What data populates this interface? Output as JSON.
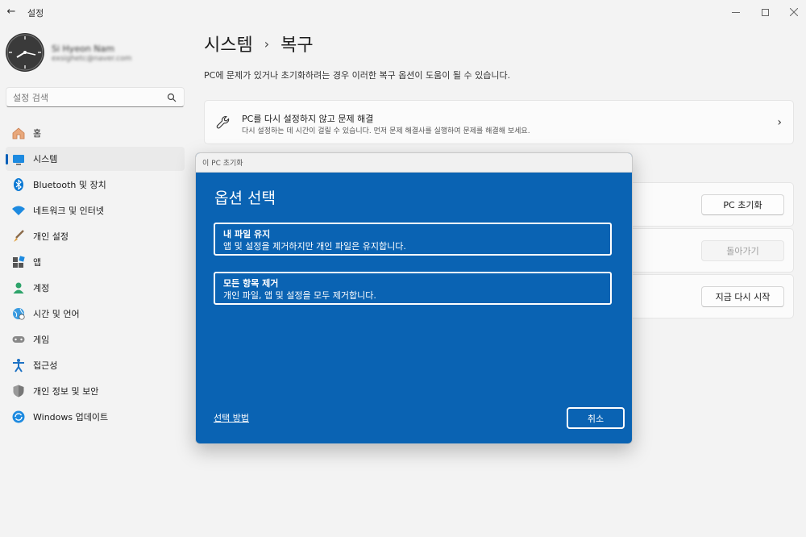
{
  "window": {
    "app_title": "설정",
    "back_icon": "back-arrow-icon"
  },
  "profile": {
    "name": "Si Hyeon Nam",
    "email": "exsighetc@naver.com"
  },
  "search": {
    "placeholder": "설정 검색"
  },
  "sidebar": {
    "items": [
      {
        "label": "홈",
        "icon": "home-icon"
      },
      {
        "label": "시스템",
        "icon": "system-icon",
        "active": true
      },
      {
        "label": "Bluetooth 및 장치",
        "icon": "bluetooth-icon"
      },
      {
        "label": "네트워크 및 인터넷",
        "icon": "network-icon"
      },
      {
        "label": "개인 설정",
        "icon": "brush-icon"
      },
      {
        "label": "앱",
        "icon": "apps-icon"
      },
      {
        "label": "계정",
        "icon": "account-icon"
      },
      {
        "label": "시간 및 언어",
        "icon": "globe-icon"
      },
      {
        "label": "게임",
        "icon": "gamepad-icon"
      },
      {
        "label": "접근성",
        "icon": "accessibility-icon"
      },
      {
        "label": "개인 정보 및 보안",
        "icon": "shield-icon"
      },
      {
        "label": "Windows 업데이트",
        "icon": "update-icon"
      }
    ]
  },
  "main": {
    "breadcrumb": [
      "시스템",
      "복구"
    ],
    "breadcrumb_sep": "›",
    "description": "PC에 문제가 있거나 초기화하려는 경우 이러한 복구 옵션이 도움이 될 수 있습니다.",
    "fix_card": {
      "title": "PC를 다시 설정하지 않고 문제 해결",
      "subtitle": "다시 설정하는 데 시간이 걸릴 수 있습니다. 먼저 문제 해결사를 실행하여 문제를 해결해 보세요."
    },
    "buttons": {
      "reset": "PC 초기화",
      "go_back": "돌아가기",
      "restart_now": "지금 다시 시작"
    }
  },
  "dialog": {
    "window_title": "이 PC 초기화",
    "heading": "옵션 선택",
    "options": [
      {
        "title": "내 파일 유지",
        "description": "앱 및 설정을 제거하지만 개인 파일은 유지합니다."
      },
      {
        "title": "모든 항목 제거",
        "description": "개인 파일, 앱 및 설정을 모두 제거합니다."
      }
    ],
    "help_link": "선택 방법",
    "cancel": "취소",
    "colors": {
      "background": "#0a63b3",
      "text": "#ffffff"
    }
  }
}
